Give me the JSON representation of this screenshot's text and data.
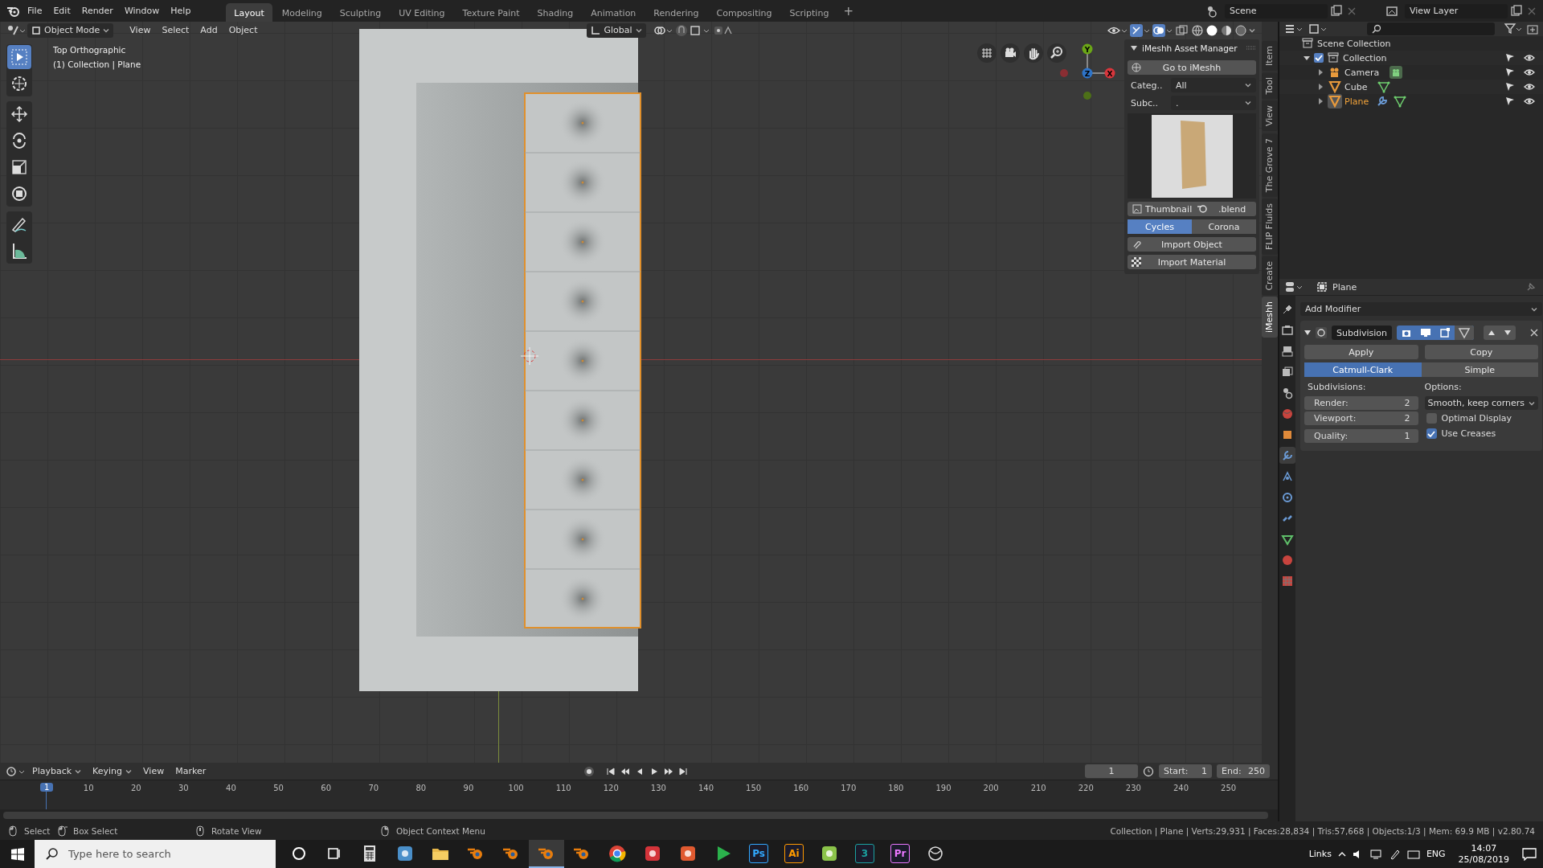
{
  "top_bar": {
    "menus": [
      "File",
      "Edit",
      "Render",
      "Window",
      "Help"
    ],
    "workspaces": [
      {
        "label": "Layout",
        "selected": true
      },
      {
        "label": "Modeling",
        "selected": false
      },
      {
        "label": "Sculpting",
        "selected": false
      },
      {
        "label": "UV Editing",
        "selected": false
      },
      {
        "label": "Texture Paint",
        "selected": false
      },
      {
        "label": "Shading",
        "selected": false
      },
      {
        "label": "Animation",
        "selected": false
      },
      {
        "label": "Rendering",
        "selected": false
      },
      {
        "label": "Compositing",
        "selected": false
      },
      {
        "label": "Scripting",
        "selected": false
      }
    ],
    "add_workspace": "+",
    "scene": "Scene",
    "view_layer": "View Layer"
  },
  "viewport": {
    "header": {
      "mode": "Object Mode",
      "menus": [
        "View",
        "Select",
        "Add",
        "Object"
      ],
      "orientation": "Global"
    },
    "tools": [
      {
        "kind": "select",
        "selected": true
      },
      {
        "kind": "cursor",
        "selected": false
      },
      {
        "kind": "move",
        "selected": false
      },
      {
        "kind": "rotate",
        "selected": false
      },
      {
        "kind": "scale",
        "selected": false
      },
      {
        "kind": "transform",
        "selected": false
      },
      {
        "kind": "annotate",
        "selected": false
      },
      {
        "kind": "measure",
        "selected": false
      }
    ],
    "view_name": "Top Orthographic",
    "view_context": "(1) Collection | Plane",
    "gizmo_labels": [
      "Y",
      "Z",
      "X"
    ],
    "sidebar": {
      "title": "iMeshh Asset Manager",
      "go_button": "Go to iMeshh",
      "fields": [
        {
          "label": "Categ..",
          "value": "All"
        },
        {
          "label": "Subc..",
          "value": "."
        }
      ],
      "thumbnail_button": "Thumbnail",
      "blend_button": ".blend",
      "engines": [
        {
          "label": "Cycles",
          "selected": true
        },
        {
          "label": "Corona",
          "selected": false
        }
      ],
      "import_object": "Import Object",
      "import_material": "Import Material",
      "tabs": [
        {
          "label": "Item",
          "selected": false
        },
        {
          "label": "Tool",
          "selected": false
        },
        {
          "label": "View",
          "selected": false
        },
        {
          "label": "The Grove 7",
          "selected": false
        },
        {
          "label": "FLIP Fluids",
          "selected": false
        },
        {
          "label": "Create",
          "selected": false
        },
        {
          "label": "iMeshh",
          "selected": true
        }
      ]
    }
  },
  "outliner": {
    "tree": [
      {
        "label": "Scene Collection",
        "kind": "scene_collection",
        "selected": false,
        "children": [
          {
            "label": "Collection",
            "kind": "collection",
            "expanded": true,
            "checked": true,
            "selected": false,
            "children": [
              {
                "label": "Camera",
                "kind": "camera",
                "expanded": false,
                "selected": false,
                "has_modifier": false
              },
              {
                "label": "Cube",
                "kind": "mesh",
                "expanded": false,
                "selected": false,
                "has_modifier": false
              },
              {
                "label": "Plane",
                "kind": "mesh",
                "expanded": false,
                "selected": true,
                "has_modifier": true
              }
            ]
          }
        ]
      }
    ]
  },
  "properties": {
    "object_name": "Plane",
    "tabs": [
      {
        "kind": "tool",
        "selected": false
      },
      {
        "kind": "render",
        "selected": false
      },
      {
        "kind": "output",
        "selected": false
      },
      {
        "kind": "view_layer",
        "selected": false
      },
      {
        "kind": "scene",
        "selected": false
      },
      {
        "kind": "world",
        "selected": false
      },
      {
        "kind": "object",
        "selected": false
      },
      {
        "kind": "modifier",
        "selected": true
      },
      {
        "kind": "particles",
        "selected": false
      },
      {
        "kind": "physics",
        "selected": false
      },
      {
        "kind": "constraints",
        "selected": false
      },
      {
        "kind": "data",
        "selected": false
      },
      {
        "kind": "material",
        "selected": false
      },
      {
        "kind": "texture",
        "selected": false
      }
    ],
    "add_modifier": "Add Modifier",
    "modifier": {
      "name": "Subdivision",
      "expanded": true,
      "toggles": [
        {
          "kind": "render",
          "on": true
        },
        {
          "kind": "viewport",
          "on": true
        },
        {
          "kind": "editmode",
          "on": true
        },
        {
          "kind": "cage",
          "on": false
        }
      ],
      "apply": "Apply",
      "copy": "Copy",
      "types": [
        {
          "label": "Catmull-Clark",
          "selected": true
        },
        {
          "label": "Simple",
          "selected": false
        }
      ],
      "subdivisions_label": "Subdivisions:",
      "numbers": [
        {
          "label": "Render:",
          "value": "2"
        },
        {
          "label": "Viewport:",
          "value": "2"
        },
        {
          "label": "Quality:",
          "value": "1"
        }
      ],
      "options_label": "Options:",
      "uv_smooth": "Smooth, keep corners",
      "checkboxes": [
        {
          "label": "Optimal Display",
          "checked": false
        },
        {
          "label": "Use Creases",
          "checked": true
        }
      ]
    }
  },
  "timeline": {
    "menus": [
      "Playback",
      "Keying",
      "View",
      "Marker"
    ],
    "current_frame": "1",
    "start_label": "Start:",
    "start": "1",
    "end_label": "End:",
    "end": "250",
    "playhead": "1",
    "ruler": [
      "10",
      "20",
      "30",
      "40",
      "50",
      "60",
      "70",
      "80",
      "90",
      "100",
      "110",
      "120",
      "130",
      "140",
      "150",
      "160",
      "170",
      "180",
      "190",
      "200",
      "210",
      "220",
      "230",
      "240",
      "250"
    ]
  },
  "status_bar": {
    "hints": [
      {
        "kind": "left_click",
        "label": "Select"
      },
      {
        "kind": "drag",
        "label": "Box Select"
      },
      {
        "kind": "middle_click",
        "label": "Rotate View"
      },
      {
        "kind": "right_click",
        "label": "Object Context Menu"
      }
    ],
    "stats": "Collection | Plane | Verts:29,931 | Faces:28,834 | Tris:57,668 | Objects:1/3 | Mem: 69.9 MB | v2.80.74"
  },
  "taskbar": {
    "search_placeholder": "Type here to search",
    "apps": [
      {
        "kind": "cortana",
        "selected": false
      },
      {
        "kind": "task_view",
        "selected": false
      },
      {
        "kind": "calculator",
        "selected": false
      },
      {
        "kind": "tile",
        "color": "#4a8fc9",
        "selected": false
      },
      {
        "kind": "folder",
        "selected": false
      },
      {
        "kind": "blender",
        "selected": false
      },
      {
        "kind": "blender",
        "selected": false
      },
      {
        "kind": "blender",
        "selected": true
      },
      {
        "kind": "blender",
        "selected": false
      },
      {
        "kind": "chrome",
        "selected": false
      },
      {
        "kind": "tile",
        "color": "#d4343a",
        "selected": false
      },
      {
        "kind": "tile",
        "color": "#e05a30",
        "selected": false
      },
      {
        "kind": "play",
        "selected": false
      },
      {
        "kind": "letter",
        "label": "Ps",
        "color": "#31a8ff",
        "selected": false
      },
      {
        "kind": "letter",
        "label": "Ai",
        "color": "#ff9a00",
        "selected": false
      },
      {
        "kind": "tile",
        "color": "#8bc34a",
        "selected": false
      },
      {
        "kind": "letter",
        "label": "3",
        "color": "#1ba1a0",
        "selected": false
      },
      {
        "kind": "letter",
        "label": "Pr",
        "color": "#ea77ff",
        "selected": false
      },
      {
        "kind": "ring",
        "selected": false
      }
    ],
    "tray": {
      "links": "Links",
      "language": "ENG",
      "time": "14:07",
      "date": "25/08/2019"
    }
  }
}
